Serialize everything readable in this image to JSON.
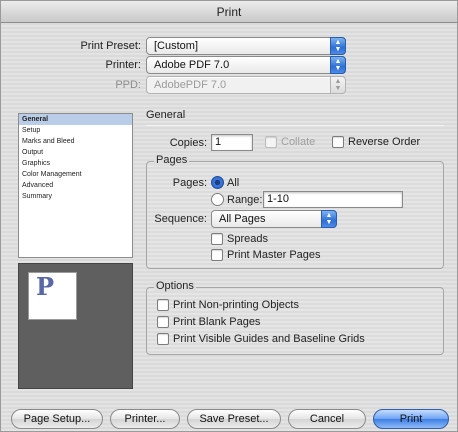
{
  "window": {
    "title": "Print"
  },
  "header": {
    "print_preset_label": "Print Preset:",
    "print_preset_value": "[Custom]",
    "printer_label": "Printer:",
    "printer_value": "Adobe PDF 7.0",
    "ppd_label": "PPD:",
    "ppd_value": "AdobePDF 7.0"
  },
  "sidebar": {
    "items": [
      {
        "label": "General",
        "selected": true
      },
      {
        "label": "Setup"
      },
      {
        "label": "Marks and Bleed"
      },
      {
        "label": "Output"
      },
      {
        "label": "Graphics"
      },
      {
        "label": "Color Management"
      },
      {
        "label": "Advanced"
      },
      {
        "label": "Summary"
      }
    ]
  },
  "preview": {
    "page_letter": "P"
  },
  "general": {
    "title": "General",
    "copies_label": "Copies:",
    "copies_value": "1",
    "collate_label": "Collate",
    "reverse_order_label": "Reverse Order",
    "pages": {
      "title": "Pages",
      "pages_label": "Pages:",
      "all_label": "All",
      "range_label": "Range:",
      "range_value": "1-10",
      "sequence_label": "Sequence:",
      "sequence_value": "All Pages",
      "spreads_label": "Spreads",
      "print_master_pages_label": "Print Master Pages"
    },
    "options": {
      "title": "Options",
      "non_printing_label": "Print Non-printing Objects",
      "blank_pages_label": "Print Blank Pages",
      "guides_label": "Print Visible Guides and Baseline Grids"
    }
  },
  "buttons": {
    "page_setup": "Page Setup...",
    "printer": "Printer...",
    "save_preset": "Save Preset...",
    "cancel": "Cancel",
    "print": "Print"
  },
  "colors": {
    "accent": "#3d7fe6",
    "selection": "#b9cde9"
  }
}
